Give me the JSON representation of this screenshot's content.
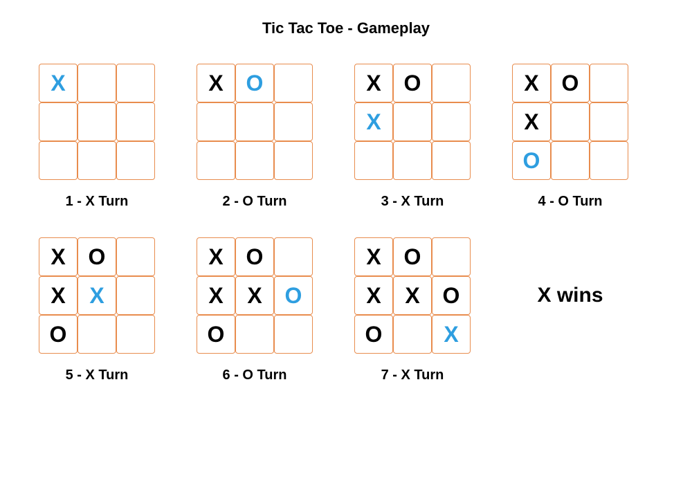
{
  "title": "Tic Tac Toe - Gameplay",
  "result": "X wins",
  "boards": [
    {
      "caption": "1 - X Turn",
      "cells": [
        {
          "mark": "X",
          "color": "blue"
        },
        {
          "mark": "",
          "color": ""
        },
        {
          "mark": "",
          "color": ""
        },
        {
          "mark": "",
          "color": ""
        },
        {
          "mark": "",
          "color": ""
        },
        {
          "mark": "",
          "color": ""
        },
        {
          "mark": "",
          "color": ""
        },
        {
          "mark": "",
          "color": ""
        },
        {
          "mark": "",
          "color": ""
        }
      ]
    },
    {
      "caption": "2 - O Turn",
      "cells": [
        {
          "mark": "X",
          "color": "black"
        },
        {
          "mark": "O",
          "color": "blue"
        },
        {
          "mark": "",
          "color": ""
        },
        {
          "mark": "",
          "color": ""
        },
        {
          "mark": "",
          "color": ""
        },
        {
          "mark": "",
          "color": ""
        },
        {
          "mark": "",
          "color": ""
        },
        {
          "mark": "",
          "color": ""
        },
        {
          "mark": "",
          "color": ""
        }
      ]
    },
    {
      "caption": "3 - X Turn",
      "cells": [
        {
          "mark": "X",
          "color": "black"
        },
        {
          "mark": "O",
          "color": "black"
        },
        {
          "mark": "",
          "color": ""
        },
        {
          "mark": "X",
          "color": "blue"
        },
        {
          "mark": "",
          "color": ""
        },
        {
          "mark": "",
          "color": ""
        },
        {
          "mark": "",
          "color": ""
        },
        {
          "mark": "",
          "color": ""
        },
        {
          "mark": "",
          "color": ""
        }
      ]
    },
    {
      "caption": "4 - O Turn",
      "cells": [
        {
          "mark": "X",
          "color": "black"
        },
        {
          "mark": "O",
          "color": "black"
        },
        {
          "mark": "",
          "color": ""
        },
        {
          "mark": "X",
          "color": "black"
        },
        {
          "mark": "",
          "color": ""
        },
        {
          "mark": "",
          "color": ""
        },
        {
          "mark": "O",
          "color": "blue"
        },
        {
          "mark": "",
          "color": ""
        },
        {
          "mark": "",
          "color": ""
        }
      ]
    },
    {
      "caption": "5 - X Turn",
      "cells": [
        {
          "mark": "X",
          "color": "black"
        },
        {
          "mark": "O",
          "color": "black"
        },
        {
          "mark": "",
          "color": ""
        },
        {
          "mark": "X",
          "color": "black"
        },
        {
          "mark": "X",
          "color": "blue"
        },
        {
          "mark": "",
          "color": ""
        },
        {
          "mark": "O",
          "color": "black"
        },
        {
          "mark": "",
          "color": ""
        },
        {
          "mark": "",
          "color": ""
        }
      ]
    },
    {
      "caption": "6 - O Turn",
      "cells": [
        {
          "mark": "X",
          "color": "black"
        },
        {
          "mark": "O",
          "color": "black"
        },
        {
          "mark": "",
          "color": ""
        },
        {
          "mark": "X",
          "color": "black"
        },
        {
          "mark": "X",
          "color": "black"
        },
        {
          "mark": "O",
          "color": "blue"
        },
        {
          "mark": "O",
          "color": "black"
        },
        {
          "mark": "",
          "color": ""
        },
        {
          "mark": "",
          "color": ""
        }
      ]
    },
    {
      "caption": "7 - X Turn",
      "cells": [
        {
          "mark": "X",
          "color": "black"
        },
        {
          "mark": "O",
          "color": "black"
        },
        {
          "mark": "",
          "color": ""
        },
        {
          "mark": "X",
          "color": "black"
        },
        {
          "mark": "X",
          "color": "black"
        },
        {
          "mark": "O",
          "color": "black"
        },
        {
          "mark": "O",
          "color": "black"
        },
        {
          "mark": "",
          "color": ""
        },
        {
          "mark": "X",
          "color": "blue"
        }
      ]
    }
  ]
}
